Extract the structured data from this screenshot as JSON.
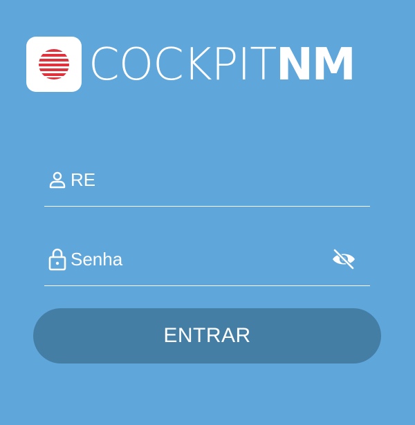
{
  "brand": {
    "name_light": "COCKPIT",
    "name_bold": "NM",
    "logo_icon": "striped-globe-icon",
    "logo_color": "#e0323c"
  },
  "form": {
    "username": {
      "placeholder": "RE",
      "value": "",
      "icon": "user-icon"
    },
    "password": {
      "placeholder": "Senha",
      "value": "",
      "icon": "lock-icon",
      "toggle_icon": "eye-off-icon"
    },
    "submit_label": "ENTRAR"
  },
  "colors": {
    "background": "#5fa6da",
    "button": "#457ea5",
    "text": "#ffffff"
  }
}
